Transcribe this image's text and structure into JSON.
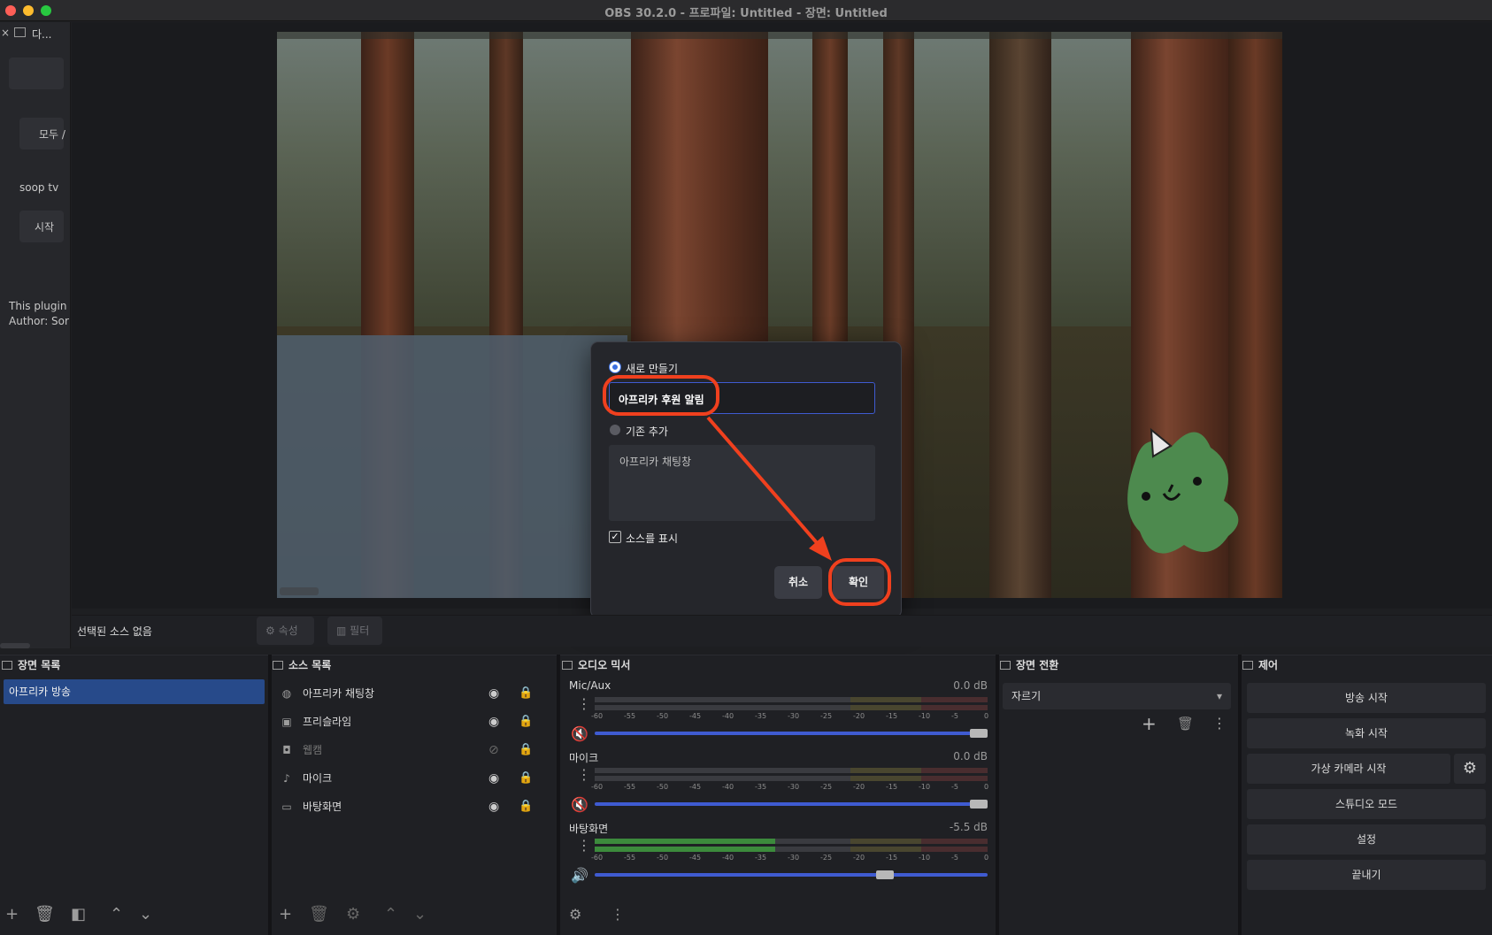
{
  "window": {
    "title": "OBS 30.2.0 - 프로파일: Untitled - 장면: Untitled"
  },
  "left_dock": {
    "close_glyph": "×",
    "title": "다...",
    "button_all": "모두 /",
    "label_soop": "soop tv",
    "button_start": "시작",
    "plugin_line1": "This plugin",
    "plugin_line2": "Author: Sor"
  },
  "dialog": {
    "option_new": "새로 만들기",
    "name_value": "아프리카 후원 알림",
    "option_existing": "기존 추가",
    "existing_items": [
      "아프리카 채팅창"
    ],
    "show_source_label": "소스를 표시",
    "show_source_checked": true,
    "cancel_label": "취소",
    "ok_label": "확인"
  },
  "context_bar": {
    "no_source": "선택된 소스 없음",
    "properties_label": "속성",
    "filters_label": "필터"
  },
  "scenes": {
    "title": "장면 목록",
    "items": [
      "아프리카 방송"
    ]
  },
  "sources": {
    "title": "소스 목록",
    "items": [
      {
        "name": "아프리카 채팅창",
        "icon": "globe-icon",
        "visible": true
      },
      {
        "name": "프리슬라임",
        "icon": "image-icon",
        "visible": true
      },
      {
        "name": "웹캠",
        "icon": "camera-icon",
        "visible": false
      },
      {
        "name": "마이크",
        "icon": "mic-icon",
        "visible": true
      },
      {
        "name": "바탕화면",
        "icon": "monitor-icon",
        "visible": true
      }
    ]
  },
  "mixer": {
    "title": "오디오 믹서",
    "scale": [
      "-60",
      "-55",
      "-50",
      "-45",
      "-40",
      "-35",
      "-30",
      "-25",
      "-20",
      "-15",
      "-10",
      "-5",
      "0"
    ],
    "channels": [
      {
        "name": "Mic/Aux",
        "db": "0.0 dB",
        "muted": true,
        "level": 0.0,
        "fader": 1.0
      },
      {
        "name": "마이크",
        "db": "0.0 dB",
        "muted": true,
        "level": 0.0,
        "fader": 1.0
      },
      {
        "name": "바탕화면",
        "db": "-5.5 dB",
        "muted": false,
        "level": 0.46,
        "fader": 0.75
      }
    ]
  },
  "transitions": {
    "title": "장면 전환",
    "selected": "자르기"
  },
  "controls": {
    "title": "제어",
    "start_stream": "방송 시작",
    "start_record": "녹화 시작",
    "virtual_camera": "가상 카메라 시작",
    "studio_mode": "스튜디오 모드",
    "settings": "설정",
    "exit": "끝내기"
  },
  "colors": {
    "accent": "#3f5bd1",
    "annotation": "#f0401e",
    "selection": "#274a8a"
  }
}
